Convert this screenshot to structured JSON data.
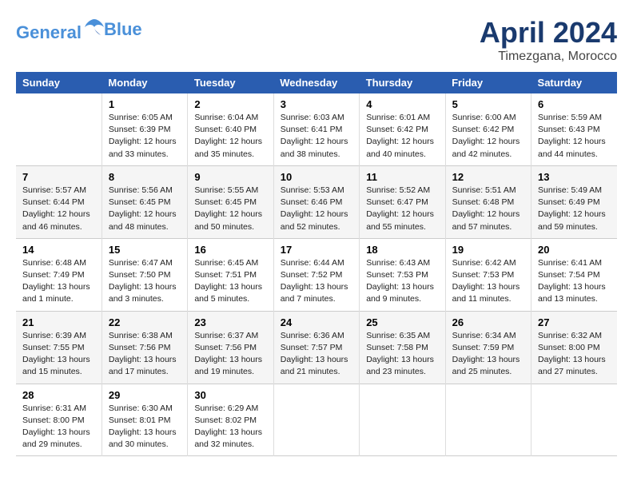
{
  "logo": {
    "line1": "General",
    "line2": "Blue"
  },
  "title": "April 2024",
  "location": "Timezgana, Morocco",
  "days_of_week": [
    "Sunday",
    "Monday",
    "Tuesday",
    "Wednesday",
    "Thursday",
    "Friday",
    "Saturday"
  ],
  "weeks": [
    [
      {
        "num": "",
        "info": ""
      },
      {
        "num": "1",
        "info": "Sunrise: 6:05 AM\nSunset: 6:39 PM\nDaylight: 12 hours\nand 33 minutes."
      },
      {
        "num": "2",
        "info": "Sunrise: 6:04 AM\nSunset: 6:40 PM\nDaylight: 12 hours\nand 35 minutes."
      },
      {
        "num": "3",
        "info": "Sunrise: 6:03 AM\nSunset: 6:41 PM\nDaylight: 12 hours\nand 38 minutes."
      },
      {
        "num": "4",
        "info": "Sunrise: 6:01 AM\nSunset: 6:42 PM\nDaylight: 12 hours\nand 40 minutes."
      },
      {
        "num": "5",
        "info": "Sunrise: 6:00 AM\nSunset: 6:42 PM\nDaylight: 12 hours\nand 42 minutes."
      },
      {
        "num": "6",
        "info": "Sunrise: 5:59 AM\nSunset: 6:43 PM\nDaylight: 12 hours\nand 44 minutes."
      }
    ],
    [
      {
        "num": "7",
        "info": "Sunrise: 5:57 AM\nSunset: 6:44 PM\nDaylight: 12 hours\nand 46 minutes."
      },
      {
        "num": "8",
        "info": "Sunrise: 5:56 AM\nSunset: 6:45 PM\nDaylight: 12 hours\nand 48 minutes."
      },
      {
        "num": "9",
        "info": "Sunrise: 5:55 AM\nSunset: 6:45 PM\nDaylight: 12 hours\nand 50 minutes."
      },
      {
        "num": "10",
        "info": "Sunrise: 5:53 AM\nSunset: 6:46 PM\nDaylight: 12 hours\nand 52 minutes."
      },
      {
        "num": "11",
        "info": "Sunrise: 5:52 AM\nSunset: 6:47 PM\nDaylight: 12 hours\nand 55 minutes."
      },
      {
        "num": "12",
        "info": "Sunrise: 5:51 AM\nSunset: 6:48 PM\nDaylight: 12 hours\nand 57 minutes."
      },
      {
        "num": "13",
        "info": "Sunrise: 5:49 AM\nSunset: 6:49 PM\nDaylight: 12 hours\nand 59 minutes."
      }
    ],
    [
      {
        "num": "14",
        "info": "Sunrise: 6:48 AM\nSunset: 7:49 PM\nDaylight: 13 hours\nand 1 minute."
      },
      {
        "num": "15",
        "info": "Sunrise: 6:47 AM\nSunset: 7:50 PM\nDaylight: 13 hours\nand 3 minutes."
      },
      {
        "num": "16",
        "info": "Sunrise: 6:45 AM\nSunset: 7:51 PM\nDaylight: 13 hours\nand 5 minutes."
      },
      {
        "num": "17",
        "info": "Sunrise: 6:44 AM\nSunset: 7:52 PM\nDaylight: 13 hours\nand 7 minutes."
      },
      {
        "num": "18",
        "info": "Sunrise: 6:43 AM\nSunset: 7:53 PM\nDaylight: 13 hours\nand 9 minutes."
      },
      {
        "num": "19",
        "info": "Sunrise: 6:42 AM\nSunset: 7:53 PM\nDaylight: 13 hours\nand 11 minutes."
      },
      {
        "num": "20",
        "info": "Sunrise: 6:41 AM\nSunset: 7:54 PM\nDaylight: 13 hours\nand 13 minutes."
      }
    ],
    [
      {
        "num": "21",
        "info": "Sunrise: 6:39 AM\nSunset: 7:55 PM\nDaylight: 13 hours\nand 15 minutes."
      },
      {
        "num": "22",
        "info": "Sunrise: 6:38 AM\nSunset: 7:56 PM\nDaylight: 13 hours\nand 17 minutes."
      },
      {
        "num": "23",
        "info": "Sunrise: 6:37 AM\nSunset: 7:56 PM\nDaylight: 13 hours\nand 19 minutes."
      },
      {
        "num": "24",
        "info": "Sunrise: 6:36 AM\nSunset: 7:57 PM\nDaylight: 13 hours\nand 21 minutes."
      },
      {
        "num": "25",
        "info": "Sunrise: 6:35 AM\nSunset: 7:58 PM\nDaylight: 13 hours\nand 23 minutes."
      },
      {
        "num": "26",
        "info": "Sunrise: 6:34 AM\nSunset: 7:59 PM\nDaylight: 13 hours\nand 25 minutes."
      },
      {
        "num": "27",
        "info": "Sunrise: 6:32 AM\nSunset: 8:00 PM\nDaylight: 13 hours\nand 27 minutes."
      }
    ],
    [
      {
        "num": "28",
        "info": "Sunrise: 6:31 AM\nSunset: 8:00 PM\nDaylight: 13 hours\nand 29 minutes."
      },
      {
        "num": "29",
        "info": "Sunrise: 6:30 AM\nSunset: 8:01 PM\nDaylight: 13 hours\nand 30 minutes."
      },
      {
        "num": "30",
        "info": "Sunrise: 6:29 AM\nSunset: 8:02 PM\nDaylight: 13 hours\nand 32 minutes."
      },
      {
        "num": "",
        "info": ""
      },
      {
        "num": "",
        "info": ""
      },
      {
        "num": "",
        "info": ""
      },
      {
        "num": "",
        "info": ""
      }
    ]
  ]
}
